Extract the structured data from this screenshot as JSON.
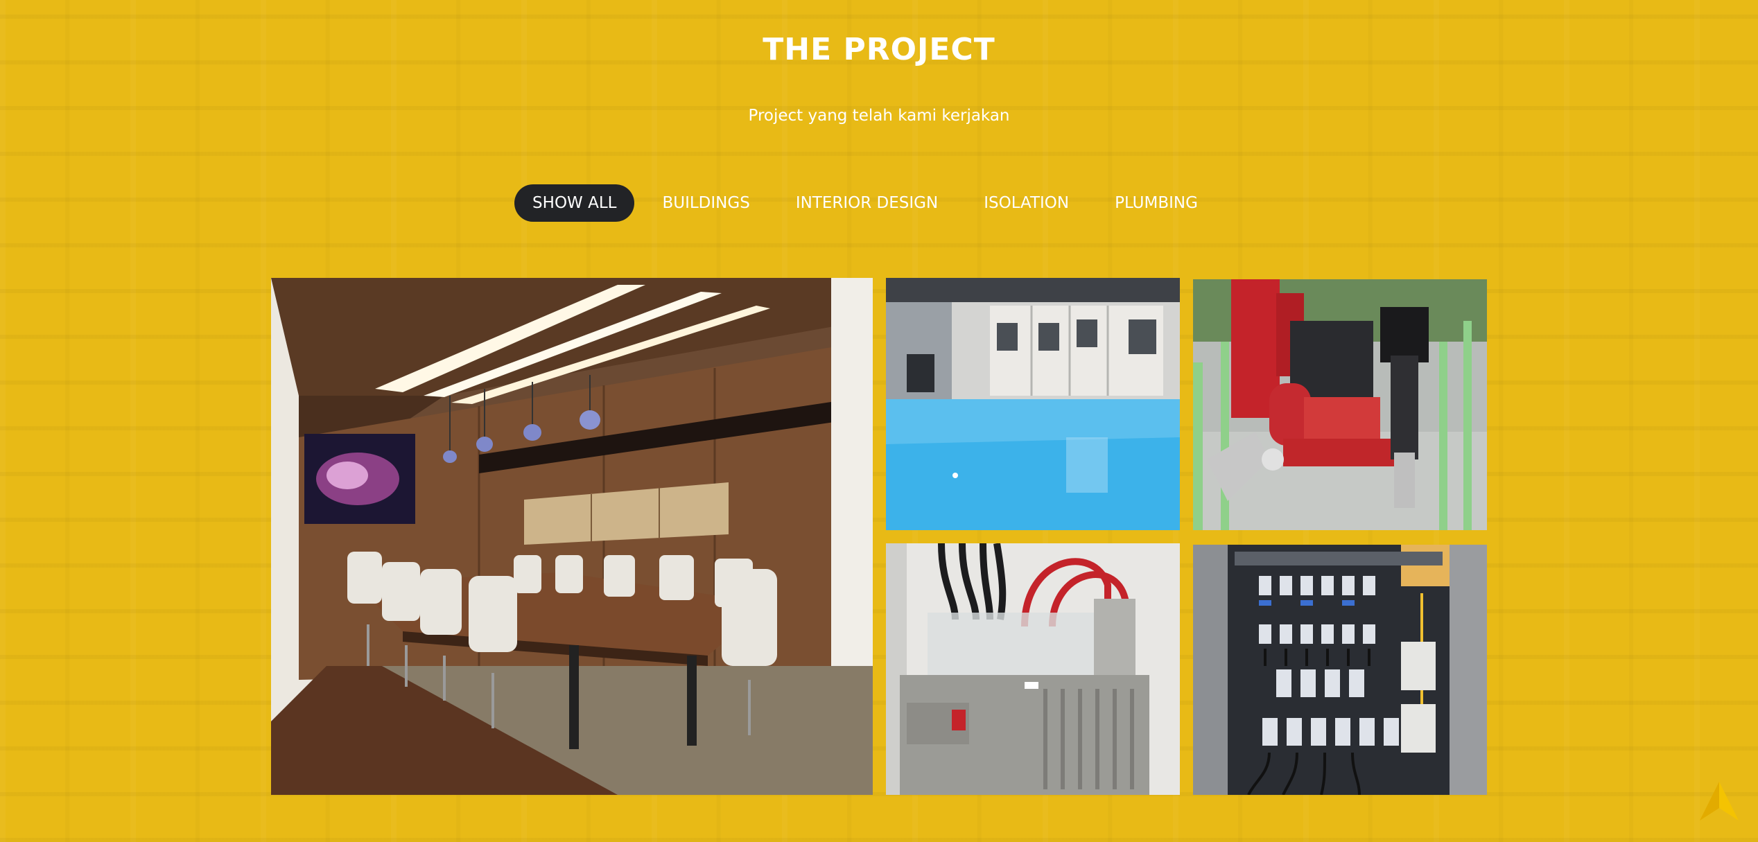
{
  "section": {
    "title": "THE PROJECT",
    "subtitle": "Project yang telah kami kerjakan"
  },
  "filters": [
    {
      "label": "SHOW ALL",
      "active": true
    },
    {
      "label": "BUILDINGS",
      "active": false
    },
    {
      "label": "INTERIOR DESIGN",
      "active": false
    },
    {
      "label": "ISOLATION",
      "active": false
    },
    {
      "label": "PLUMBING",
      "active": false
    }
  ],
  "gallery": {
    "items": [
      {
        "subject": "conference-room"
      },
      {
        "subject": "epoxy-floor"
      },
      {
        "subject": "fire-pump"
      },
      {
        "subject": "transformer"
      },
      {
        "subject": "electrical-panel"
      }
    ]
  },
  "colors": {
    "background": "#e8ba16",
    "active_filter": "#222326",
    "text": "#ffffff"
  },
  "icons": {
    "scroll_top": "chevron-up-icon"
  }
}
